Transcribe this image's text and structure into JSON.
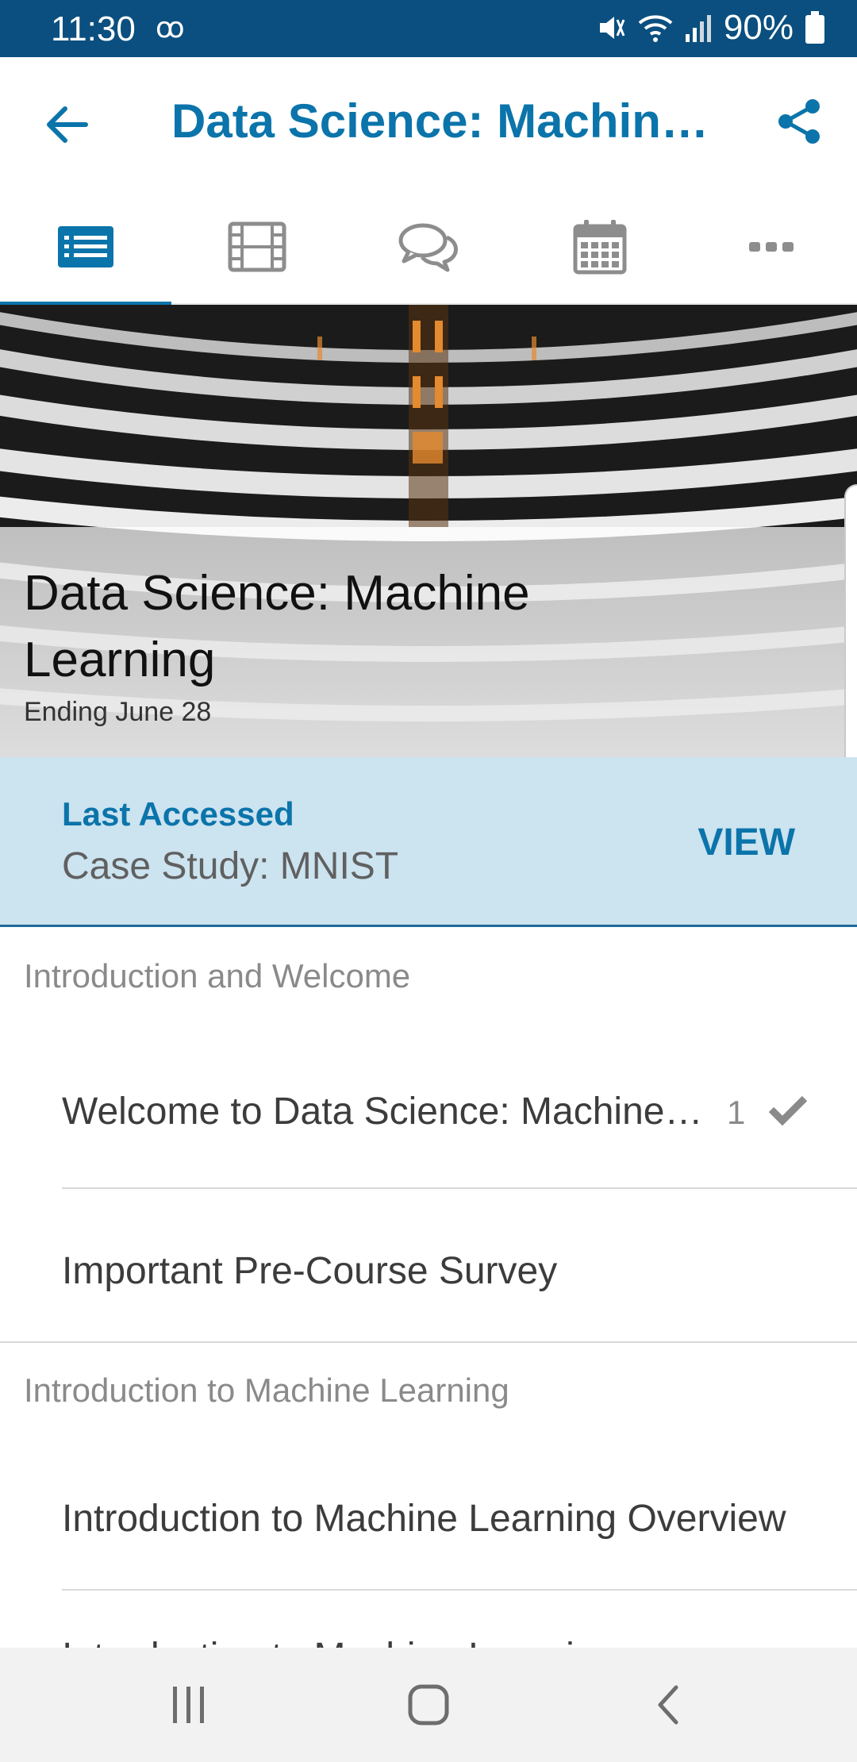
{
  "status_bar": {
    "time": "11:30",
    "voicemail": "ꝏ",
    "battery": "90%"
  },
  "header": {
    "title": "Data Science: Machin…",
    "back_icon": "arrow-left-icon",
    "share_icon": "share-icon"
  },
  "tabs": [
    {
      "icon": "list-icon",
      "active": true
    },
    {
      "icon": "film-icon",
      "active": false
    },
    {
      "icon": "chat-bubbles-icon",
      "active": false
    },
    {
      "icon": "calendar-icon",
      "active": false
    },
    {
      "icon": "more-dots-icon",
      "active": false
    }
  ],
  "hero": {
    "title": "Data Science: Machine Learning",
    "subtitle": "Ending June 28"
  },
  "last_accessed": {
    "label": "Last Accessed",
    "value": "Case Study: MNIST",
    "action": "VIEW"
  },
  "sections": [
    {
      "title": "Introduction and Welcome",
      "items": [
        {
          "label": "Welcome to Data Science: Machine…",
          "count": "1",
          "completed": true
        },
        {
          "label": "Important Pre-Course Survey"
        }
      ]
    },
    {
      "title": "Introduction to Machine Learning",
      "items": [
        {
          "label": "Introduction to Machine Learning Overview"
        },
        {
          "label": "Introduction to Machine Learning"
        }
      ]
    }
  ],
  "colors": {
    "accent": "#0b74aa",
    "status_bar": "#0a4f7f",
    "last_accessed_bg": "#cce3f0"
  }
}
